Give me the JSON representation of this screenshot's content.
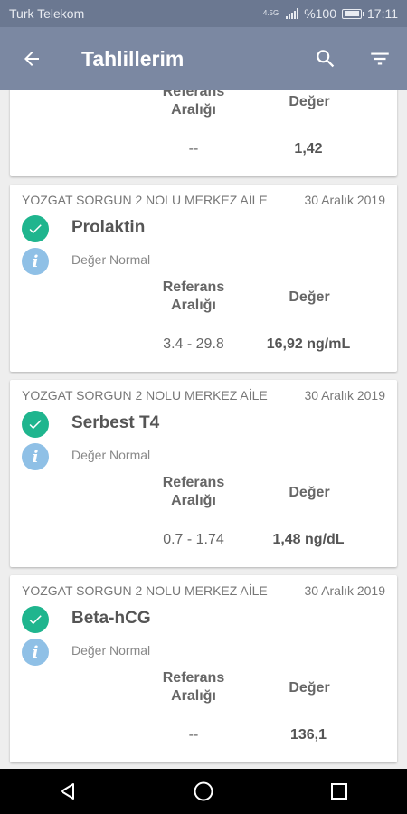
{
  "status_bar": {
    "carrier": "Turk Telekom",
    "network": "4.5G",
    "battery": "%100",
    "time": "17:11"
  },
  "app_bar": {
    "title": "Tahlillerim",
    "back_icon": "arrow-left-icon",
    "search_icon": "search-icon",
    "filter_icon": "filter-icon"
  },
  "colors": {
    "app_bar": "#7b88a2",
    "status_bar": "#6b7891",
    "check": "#1fb58e",
    "info": "#8fc0e6"
  },
  "partial_card": {
    "ref_header": "Referans\nAralığı",
    "value_header": "Değer",
    "ref_range": "--",
    "value": "1,42"
  },
  "results": [
    {
      "institution": "YOZGAT SORGUN 2 NOLU MERKEZ AİLE",
      "date": "30 Aralık 2019",
      "test_name": "Prolaktin",
      "status": "Değer Normal",
      "ref_header": "Referans\nAralığı",
      "value_header": "Değer",
      "ref_range": "3.4 - 29.8",
      "value": "16,92 ng/mL"
    },
    {
      "institution": "YOZGAT SORGUN 2 NOLU MERKEZ AİLE",
      "date": "30 Aralık 2019",
      "test_name": "Serbest T4",
      "status": "Değer Normal",
      "ref_header": "Referans\nAralığı",
      "value_header": "Değer",
      "ref_range": "0.7 - 1.74",
      "value": "1,48 ng/dL"
    },
    {
      "institution": "YOZGAT SORGUN 2 NOLU MERKEZ AİLE",
      "date": "30 Aralık 2019",
      "test_name": "Beta-hCG",
      "status": "Değer Normal",
      "ref_header": "Referans\nAralığı",
      "value_header": "Değer",
      "ref_range": "--",
      "value": "136,1"
    }
  ],
  "nav_bar": {
    "back": "triangle-back-icon",
    "home": "circle-home-icon",
    "recents": "square-recents-icon"
  }
}
